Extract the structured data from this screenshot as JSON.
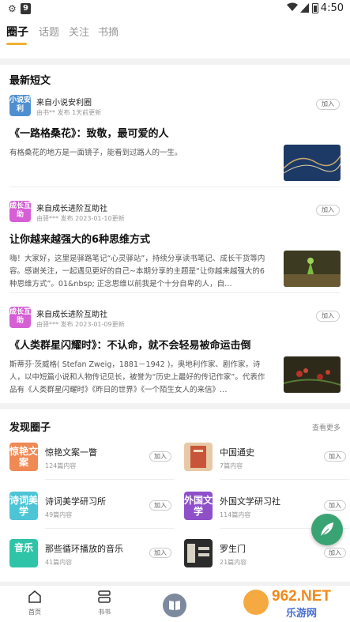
{
  "status_bar": {
    "time": "4:50",
    "notification_badge": "9"
  },
  "top_tabs": [
    {
      "label": "圈子",
      "active": true
    },
    {
      "label": "话题",
      "active": false
    },
    {
      "label": "关注",
      "active": false
    },
    {
      "label": "书摘",
      "active": false
    }
  ],
  "accent_color": "#f2b134",
  "latest": {
    "title": "最新短文",
    "posts": [
      {
        "avatar_text": "小说安利",
        "avatar_color": "#4f8fd1",
        "from": "来自小说安利圈",
        "meta": "由书** 发布  1天前更新",
        "join_label": "加入",
        "headline": "《一路格桑花》：致敬，最可爱的人",
        "excerpt": "有格桑花的地方是一面镜子，能看到过路人的一生。"
      },
      {
        "avatar_text": "成长互助",
        "avatar_color": "#d65fd6",
        "from": "来自成长进阶互助社",
        "meta": "由驿*** 发布  2023-01-10更新",
        "join_label": "加入",
        "headline": "让你越来越强大的6种思维方式",
        "excerpt": "嗨！大家好，这里是驿路笔记“心灵驿站”，持续分享读书笔记、成长干货等内容。感谢关注，一起遇见更好的自己~本期分享的主题是“让你越来越强大的6种思维方式”。01&nbsp; 正念思维以前我是个十分自卑的人，自…"
      },
      {
        "avatar_text": "成长互助",
        "avatar_color": "#d65fd6",
        "from": "来自成长进阶互助社",
        "meta": "由驿*** 发布  2023-01-09更新",
        "join_label": "加入",
        "headline": "《人类群星闪耀时》：不认命，就不会轻易被命运击倒",
        "excerpt": "斯蒂芬·茨威格( Stefan Zweig，1881－1942 )，奥地利作家、剧作家，诗人，以中短篇小说和人物传记见长，被誉为“历史上最好的传记作家”。代表作品有《人类群星闪耀时》《昨日的世界》《一个陌生女人的来信》…"
      }
    ]
  },
  "discover": {
    "title": "发现圈子",
    "see_more": "查看更多",
    "circles": [
      {
        "name": "惊艳文案一瞥",
        "count": "124篇内容",
        "icon_text": "惊艳文案",
        "icon_color": "#ef8a55",
        "join_label": "加入"
      },
      {
        "name": "中国通史",
        "count": "7篇内容",
        "icon_text": "",
        "icon_color": "#d9a77a",
        "join_label": "加入"
      },
      {
        "name": "诗词美学研习所",
        "count": "49篇内容",
        "icon_text": "诗词美学",
        "icon_color": "#4ec5d6",
        "join_label": "加入"
      },
      {
        "name": "外国文学研习社",
        "count": "114篇内容",
        "icon_text": "外国文学",
        "icon_color": "#8e4fc9",
        "join_label": "加入"
      },
      {
        "name": "那些循环播放的音乐",
        "count": "41篇内容",
        "icon_text": "音乐",
        "icon_color": "#2fc4a8",
        "join_label": "加入"
      },
      {
        "name": "罗生门",
        "count": "21篇内容",
        "icon_text": "",
        "icon_color": "#3a3a3a",
        "join_label": "加入"
      }
    ]
  },
  "bottom_nav": [
    {
      "label": "首页",
      "icon": "home-icon"
    },
    {
      "label": "书书",
      "icon": "bookshelf-icon"
    },
    {
      "label": "",
      "icon": "open-book-icon"
    }
  ],
  "watermark_text": "962.NET 乐游网"
}
